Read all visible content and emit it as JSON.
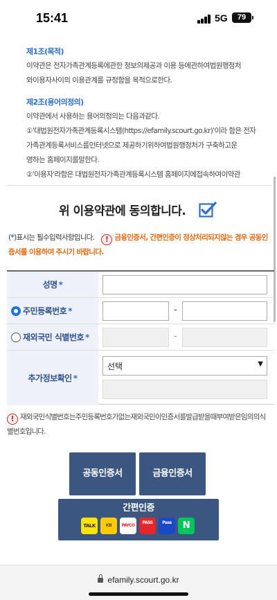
{
  "status": {
    "time": "15:41",
    "network": "5G",
    "battery": "79"
  },
  "terms": {
    "art1_title": "제1조(목적)",
    "art1_line1": "이약관은 전자가족관계등록에관한 정보의제공과 이용 등에관하여법원행정처",
    "art1_line2": "와이용자사이의 이용관계를 규정함을 목적으로한다.",
    "art2_title": "제2조(용어의정의)",
    "art2_line1": "이약관에서 사용하는 용어의정의는 다음과같다.",
    "art2_line2": "①'대법원전자가족관계등록시스템(https://efamily.scourt.go.kr)'이라 함은 전자",
    "art2_line3": "가족관계등록서비스를인터넷으로 제공하기위하여법원행정처가 구축하고운",
    "art2_line4": "영하는 홈페이지를말한다.",
    "art2_line5": "②'이용자'라함은 대법원전자가족관계등록시스템 홈페이지에접속하여이약관"
  },
  "agree": {
    "label": "위 이용약관에 동의합니다.",
    "checked": true
  },
  "notice": {
    "required_prefix": "(",
    "required_star": "*",
    "required_suffix": ")표시는 필수입력사항입니다.",
    "warning_icon": "!",
    "warning_text": "금융인증서, 간편인증이 정상처리되지않는 경우 공동인증서를 이용하여 주시기 바랍니다."
  },
  "form": {
    "name_label": "성명",
    "rrn_label": "주민등록번호",
    "foreign_label": "재외국민 식별번호",
    "extra_label": "추가정보확인",
    "star": "*",
    "dash": "-",
    "select_value": "선택"
  },
  "info": {
    "icon": "!",
    "text": "재외국민식별번호는주민등록번호가없는재외국민이인증서를발급받을때부여받은임의의식별번호입니다."
  },
  "buttons": {
    "joint_cert": "공동인증서",
    "fin_cert": "금융인증서",
    "simple_auth": "간편인증"
  },
  "simple_providers": [
    {
      "name": "kakaotalk",
      "label": "TALK"
    },
    {
      "name": "kb",
      "label": "KB"
    },
    {
      "name": "payco",
      "label": "PAYCO"
    },
    {
      "name": "pass",
      "label": "PASS"
    },
    {
      "name": "samsung-pass",
      "label": "Pass"
    },
    {
      "name": "naver",
      "label": "N"
    }
  ],
  "url": {
    "domain": "efamily.scourt.go.kr"
  },
  "colors": {
    "accent_blue": "#2f6fc6",
    "button_navy": "#3b5680",
    "warning_orange": "#e06a13"
  }
}
